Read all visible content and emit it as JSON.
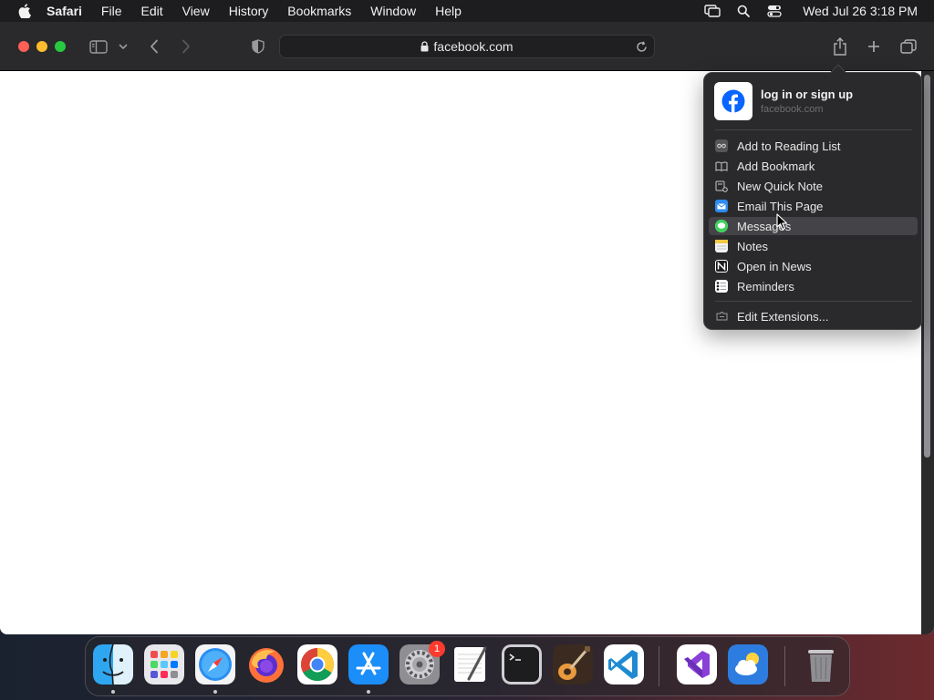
{
  "menubar": {
    "app_name": "Safari",
    "items": [
      "File",
      "Edit",
      "View",
      "History",
      "Bookmarks",
      "Window",
      "Help"
    ],
    "clock": "Wed Jul 26  3:18 PM",
    "status_icons": [
      "screen-mirroring-icon",
      "spotlight-search-icon",
      "control-center-icon"
    ]
  },
  "toolbar": {
    "address": "facebook.com"
  },
  "share_menu": {
    "title": "log in or sign up",
    "subtitle": "facebook.com",
    "items": [
      {
        "label": "Add to Reading List",
        "icon": "reading-list-icon"
      },
      {
        "label": "Add Bookmark",
        "icon": "bookmark-icon"
      },
      {
        "label": "New Quick Note",
        "icon": "quick-note-icon"
      },
      {
        "label": "Email This Page",
        "icon": "mail-icon"
      },
      {
        "label": "Messages",
        "icon": "messages-icon"
      },
      {
        "label": "Notes",
        "icon": "notes-icon"
      },
      {
        "label": "Open in News",
        "icon": "news-icon"
      },
      {
        "label": "Reminders",
        "icon": "reminders-icon"
      }
    ],
    "edit_label": "Edit Extensions..."
  },
  "dock": {
    "apps": [
      "Finder",
      "Launchpad",
      "Safari",
      "Firefox",
      "Google Chrome",
      "App Store",
      "System Settings",
      "TextEdit",
      "Terminal",
      "GarageBand",
      "Visual Studio Code",
      "Visual Studio",
      "Weather",
      "Trash"
    ],
    "settings_badge": "1"
  },
  "colors": {
    "close": "#ff5f57",
    "minimize": "#febc2e",
    "maximize": "#28c840",
    "facebook_blue": "#0866ff"
  }
}
